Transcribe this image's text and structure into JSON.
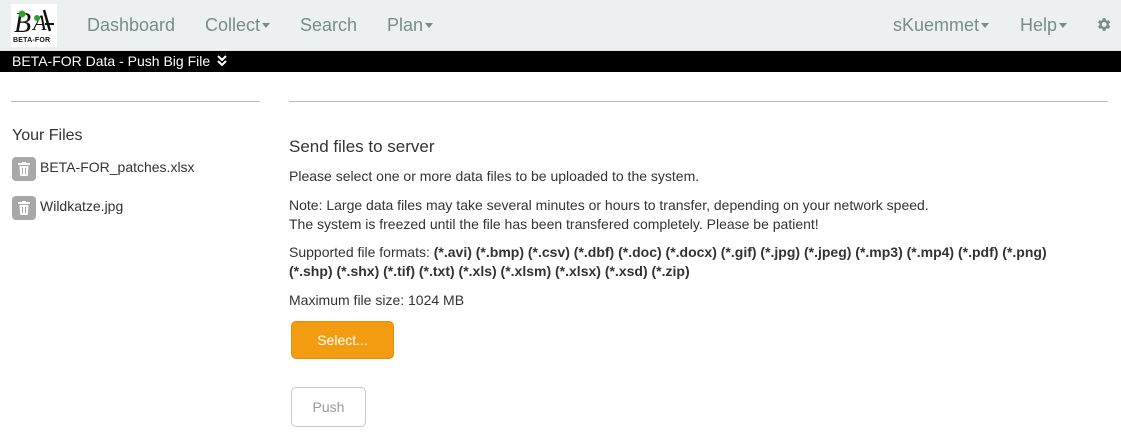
{
  "navbar": {
    "logo_icon": "beta-for-logo",
    "logo_text": "BETA-FOR",
    "items": [
      {
        "label": "Dashboard",
        "has_dropdown": false
      },
      {
        "label": "Collect",
        "has_dropdown": true
      },
      {
        "label": "Search",
        "has_dropdown": false
      },
      {
        "label": "Plan",
        "has_dropdown": true
      }
    ],
    "user": {
      "label": "sKuemmet",
      "has_dropdown": true
    },
    "help": {
      "label": "Help",
      "has_dropdown": true
    },
    "settings_icon": "gear-icon"
  },
  "titlebar": {
    "label": "BETA-FOR Data - Push Big File",
    "icon": "double-chevron-down-icon"
  },
  "sidebar": {
    "title": "Your Files",
    "files": [
      {
        "name": "BETA-FOR_patches.xlsx",
        "icon": "trash-icon"
      },
      {
        "name": "Wildkatze.jpg",
        "icon": "trash-icon"
      }
    ]
  },
  "main": {
    "title": "Send files to server",
    "instruction": "Please select one or more data files to be uploaded to the system.",
    "note_line1": "Note: Large data files may take several minutes or hours to transfer, depending on your network speed.",
    "note_line2": "The system is freezed until the file has been transfered completely. Please be patient!",
    "formats_label": "Supported file formats:",
    "formats_line1": "(*.avi) (*.bmp) (*.csv) (*.dbf) (*.doc) (*.docx) (*.gif) (*.jpg) (*.jpeg) (*.mp3) (*.mp4) (*.pdf) (*.png)",
    "formats_line2": "(*.shp) (*.shx) (*.tif) (*.txt) (*.xls) (*.xlsm) (*.xlsx) (*.xsd) (*.zip)",
    "max_size": "Maximum file size: 1024 MB",
    "select_button": "Select...",
    "push_button": "Push"
  },
  "colors": {
    "navbar_bg": "#ecf0f1",
    "nav_text": "#7b8a8b",
    "titlebar_bg": "#000000",
    "select_button_bg": "#f39c12",
    "trash_bg": "#a8a8a8"
  }
}
